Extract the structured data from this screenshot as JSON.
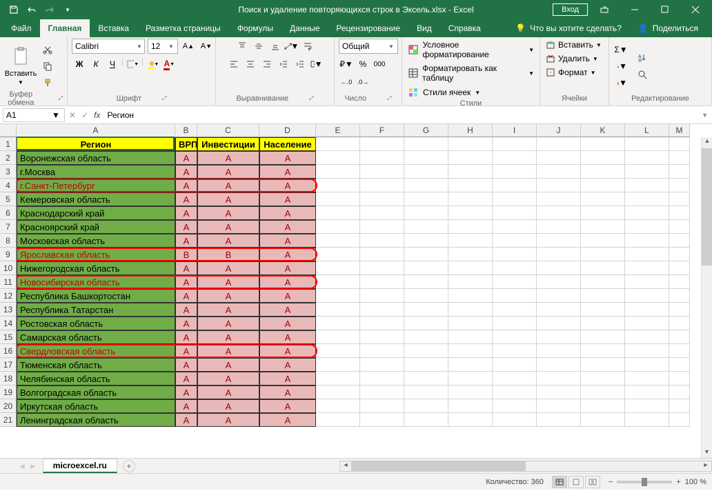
{
  "title": "Поиск и удаление повторяющихся строк в Эксель.xlsx  -  Excel",
  "login": "Вход",
  "tabs": [
    "Файл",
    "Главная",
    "Вставка",
    "Разметка страницы",
    "Формулы",
    "Данные",
    "Рецензирование",
    "Вид",
    "Справка"
  ],
  "tell_me": "Что вы хотите сделать?",
  "share": "Поделиться",
  "ribbon": {
    "paste": "Вставить",
    "clipboard": "Буфер обмена",
    "font_name": "Calibri",
    "font_size": "12",
    "font": "Шрифт",
    "alignment": "Выравнивание",
    "number_format": "Общий",
    "number": "Число",
    "cond_format": "Условное форматирование",
    "format_table": "Форматировать как таблицу",
    "cell_styles": "Стили ячеек",
    "styles": "Стили",
    "insert": "Вставить",
    "delete": "Удалить",
    "format": "Формат",
    "cells": "Ячейки",
    "editing": "Редактирование"
  },
  "name_box": "A1",
  "formula": "Регион",
  "cols": {
    "A": 230,
    "B": 32,
    "C": 90,
    "D": 82,
    "E": 64,
    "F": 64,
    "G": 64,
    "H": 64,
    "I": 64,
    "J": 64,
    "K": 64,
    "L": 64,
    "M": 30
  },
  "headers": [
    "Регион",
    "ВРП",
    "Инвестиции",
    "Население"
  ],
  "rows": [
    {
      "r": "Воронежская область",
      "v": [
        "A",
        "A",
        "A"
      ]
    },
    {
      "r": "г.Москва",
      "v": [
        "A",
        "A",
        "A"
      ]
    },
    {
      "r": "г.Санкт-Петербург",
      "v": [
        "A",
        "A",
        "A"
      ],
      "hl": true
    },
    {
      "r": "Кемеровская область",
      "v": [
        "A",
        "A",
        "A"
      ]
    },
    {
      "r": "Краснодарский край",
      "v": [
        "A",
        "A",
        "A"
      ]
    },
    {
      "r": "Красноярский край",
      "v": [
        "A",
        "A",
        "A"
      ]
    },
    {
      "r": "Московская область",
      "v": [
        "A",
        "A",
        "A"
      ]
    },
    {
      "r": "Ярославская область",
      "v": [
        "B",
        "B",
        "A"
      ],
      "hl": true
    },
    {
      "r": "Нижегородская область",
      "v": [
        "A",
        "A",
        "A"
      ]
    },
    {
      "r": "Новосибирская область",
      "v": [
        "A",
        "A",
        "A"
      ],
      "hl": true
    },
    {
      "r": "Республика Башкортостан",
      "v": [
        "A",
        "A",
        "A"
      ]
    },
    {
      "r": "Республика Татарстан",
      "v": [
        "A",
        "A",
        "A"
      ]
    },
    {
      "r": "Ростовская область",
      "v": [
        "A",
        "A",
        "A"
      ]
    },
    {
      "r": "Самарская область",
      "v": [
        "A",
        "A",
        "A"
      ]
    },
    {
      "r": "Свердловская область",
      "v": [
        "A",
        "A",
        "A"
      ],
      "hl": true
    },
    {
      "r": "Тюменская область",
      "v": [
        "A",
        "A",
        "A"
      ]
    },
    {
      "r": "Челябинская область",
      "v": [
        "A",
        "A",
        "A"
      ]
    },
    {
      "r": "Волгоградская область",
      "v": [
        "A",
        "A",
        "A"
      ]
    },
    {
      "r": "Иркутская область",
      "v": [
        "A",
        "A",
        "A"
      ]
    },
    {
      "r": "Ленинградская область",
      "v": [
        "A",
        "A",
        "A"
      ]
    }
  ],
  "sheet": "microexcel.ru",
  "status_count": "Количество: 360",
  "zoom": "100 %"
}
